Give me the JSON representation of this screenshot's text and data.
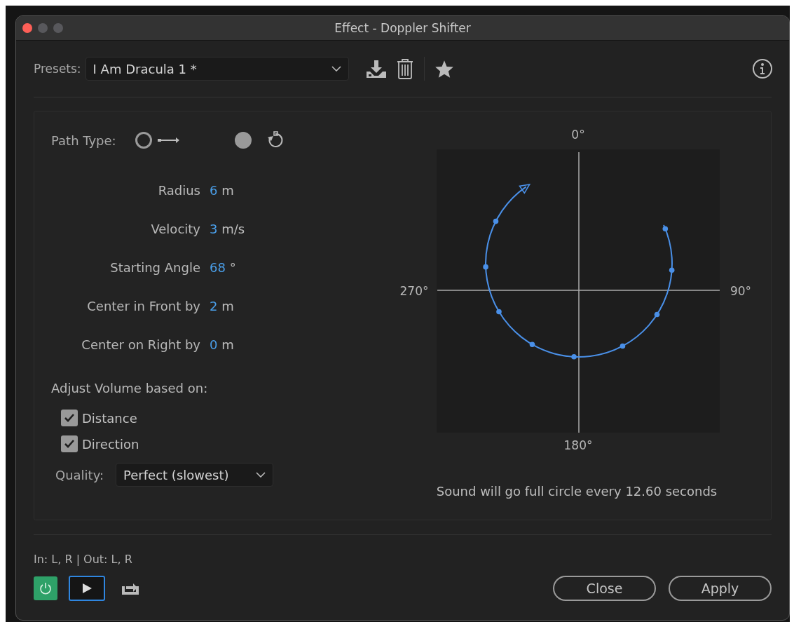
{
  "window": {
    "title": "Effect - Doppler Shifter"
  },
  "presets": {
    "label": "Presets:",
    "value": "I Am Dracula 1 *"
  },
  "path_type": {
    "label": "Path Type:",
    "options": [
      {
        "kind": "straight",
        "selected": false
      },
      {
        "kind": "circular",
        "selected": true
      }
    ]
  },
  "params": [
    {
      "label": "Radius",
      "value": "6",
      "unit": "m"
    },
    {
      "label": "Velocity",
      "value": "3",
      "unit": "m/s"
    },
    {
      "label": "Starting Angle",
      "value": "68",
      "unit": "°"
    },
    {
      "label": "Center in Front by",
      "value": "2",
      "unit": "m"
    },
    {
      "label": "Center on Right by",
      "value": "0",
      "unit": "m"
    }
  ],
  "volume": {
    "label": "Adjust Volume based on:",
    "options": [
      {
        "label": "Distance",
        "checked": true
      },
      {
        "label": "Direction",
        "checked": true
      }
    ]
  },
  "quality": {
    "label": "Quality:",
    "value": "Perfect (slowest)"
  },
  "diagram": {
    "top": "0°",
    "right": "90°",
    "bottom": "180°",
    "left": "270°",
    "caption": "Sound will go full circle every 12.60 seconds"
  },
  "io": "In: L, R | Out: L, R",
  "footer": {
    "power_on": true,
    "buttons": [
      "Close",
      "Apply"
    ]
  }
}
